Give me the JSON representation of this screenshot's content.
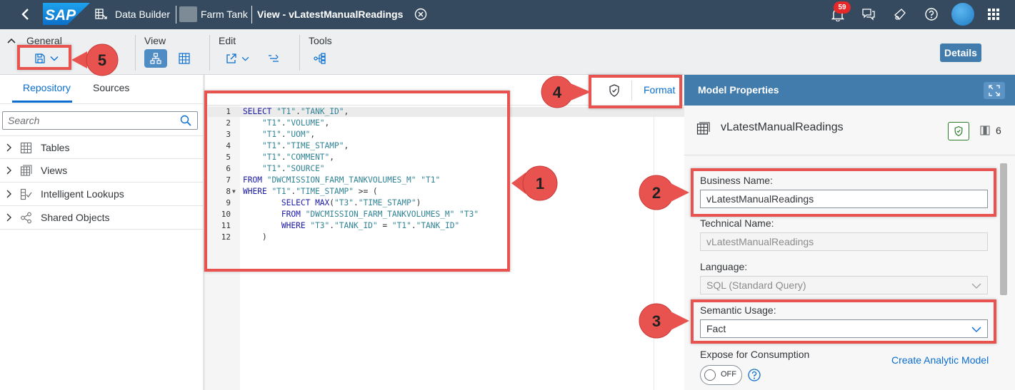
{
  "shell": {
    "logo": "SAP",
    "app_name": "Data Builder",
    "space_name": "Farm Tank",
    "editor_title": "View - vLatestManualReadings",
    "notification_count": "59"
  },
  "toolbar": {
    "groups": {
      "general": "General",
      "view": "View",
      "edit": "Edit",
      "tools": "Tools"
    },
    "details_label": "Details"
  },
  "left_panel": {
    "tabs": [
      "Repository",
      "Sources"
    ],
    "search_placeholder": "Search",
    "tree": [
      {
        "label": "Tables",
        "icon": "table-icon"
      },
      {
        "label": "Views",
        "icon": "views-icon"
      },
      {
        "label": "Intelligent Lookups",
        "icon": "lookup-icon"
      },
      {
        "label": "Shared Objects",
        "icon": "share-icon"
      }
    ]
  },
  "editor": {
    "format_label": "Format",
    "lines": [
      {
        "num": "1",
        "code": "SELECT \"T1\".\"TANK_ID\","
      },
      {
        "num": "2",
        "code": "    \"T1\".\"VOLUME\","
      },
      {
        "num": "3",
        "code": "    \"T1\".\"UOM\","
      },
      {
        "num": "4",
        "code": "    \"T1\".\"TIME_STAMP\","
      },
      {
        "num": "5",
        "code": "    \"T1\".\"COMMENT\","
      },
      {
        "num": "6",
        "code": "    \"T1\".\"SOURCE\""
      },
      {
        "num": "7",
        "code": "FROM \"DWCMISSION_FARM_TANKVOLUMES_M\" \"T1\""
      },
      {
        "num": "8",
        "code": "WHERE \"T1\".\"TIME_STAMP\" >= ("
      },
      {
        "num": "9",
        "code": "        SELECT MAX(\"T3\".\"TIME_STAMP\")"
      },
      {
        "num": "10",
        "code": "        FROM \"DWCMISSION_FARM_TANKVOLUMES_M\" \"T3\""
      },
      {
        "num": "11",
        "code": "        WHERE \"T3\".\"TANK_ID\" = \"T1\".\"TANK_ID\""
      },
      {
        "num": "12",
        "code": "    )"
      }
    ]
  },
  "properties": {
    "title": "Model Properties",
    "object_name": "vLatestManualReadings",
    "column_count": "6",
    "business_name_label": "Business Name:",
    "business_name": "vLatestManualReadings",
    "technical_name_label": "Technical Name:",
    "technical_name": "vLatestManualReadings",
    "language_label": "Language:",
    "language": "SQL (Standard Query)",
    "semantic_usage_label": "Semantic Usage:",
    "semantic_usage": "Fact",
    "expose_label": "Expose for Consumption",
    "toggle_state": "OFF",
    "create_link": "Create Analytic Model"
  },
  "annotations": [
    "1",
    "2",
    "3",
    "4",
    "5"
  ],
  "colors": {
    "shell": "#354a5f",
    "accent": "#0a6ed1",
    "panel_header": "#427cac",
    "annotation": "#e8524f"
  }
}
